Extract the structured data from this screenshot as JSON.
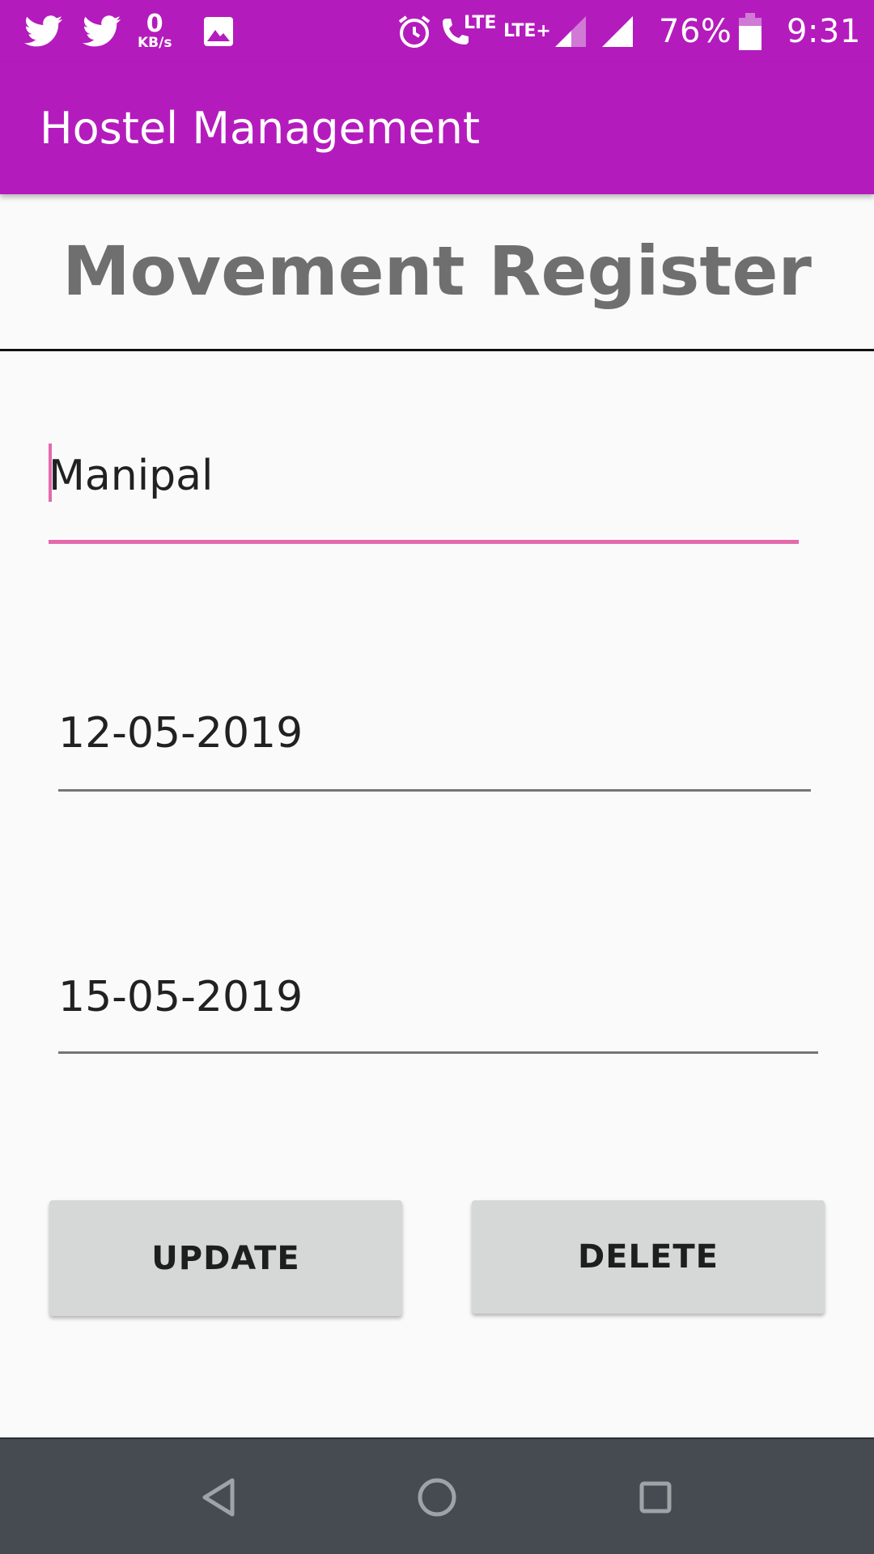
{
  "status_bar": {
    "data_speed_value": "0",
    "data_speed_unit": "KB/s",
    "lte_call": "LTE",
    "lte_plus": "LTE+",
    "battery": "76%",
    "time": "9:31",
    "icons": [
      "twitter-icon",
      "twitter-icon",
      "image-icon",
      "alarm-icon",
      "volte-call-icon",
      "signal-icon",
      "signal-icon",
      "battery-icon"
    ]
  },
  "app_bar": {
    "title": "Hostel Management"
  },
  "page": {
    "heading": "Movement Register"
  },
  "form": {
    "place_value": "Manipal",
    "from_date_value": "12-05-2019",
    "to_date_value": "15-05-2019"
  },
  "actions": {
    "update_label": "UPDATE",
    "delete_label": "DELETE"
  },
  "nav_bar": {
    "icons": [
      "back-icon",
      "home-icon",
      "recents-icon"
    ]
  },
  "colors": {
    "primary": "#b41bbc",
    "accent": "#e36aac",
    "button": "#d6d7d7",
    "nav_bar": "#454b51"
  }
}
